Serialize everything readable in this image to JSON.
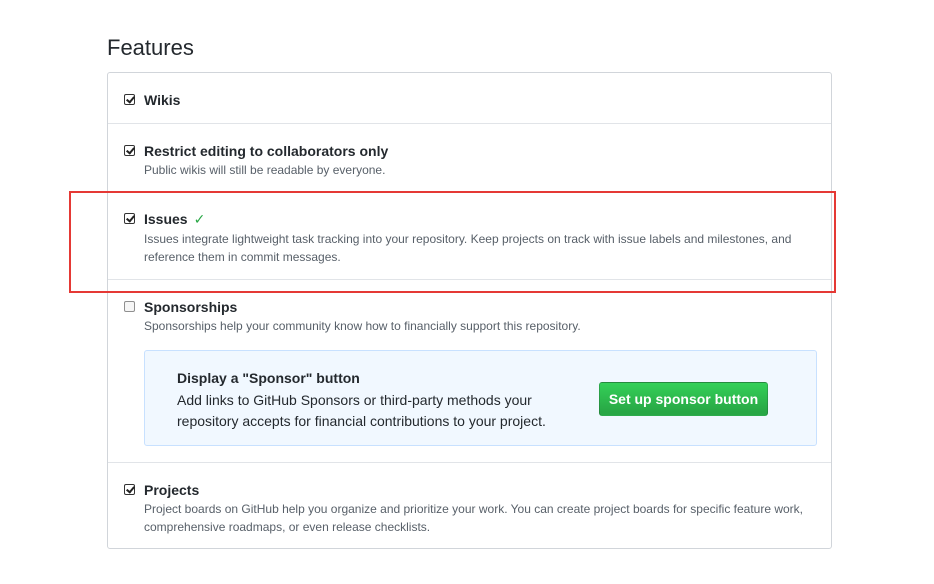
{
  "section_title": "Features",
  "features": {
    "wikis": {
      "label": "Wikis",
      "checked": true
    },
    "restrict_editing": {
      "label": "Restrict editing to collaborators only",
      "note": "Public wikis will still be readable by everyone.",
      "checked": true
    },
    "issues": {
      "label": "Issues",
      "note": "Issues integrate lightweight task tracking into your repository. Keep projects on track with issue labels and milestones, and reference them in commit messages.",
      "checked": true,
      "status_icon": "check-icon"
    },
    "sponsorships": {
      "label": "Sponsorships",
      "note": "Sponsorships help your community know how to financially support this repository.",
      "checked": false,
      "callout": {
        "title": "Display a \"Sponsor\" button",
        "description": "Add links to GitHub Sponsors or third-party methods your repository accepts for financial contributions to your project.",
        "button_label": "Set up sponsor button"
      }
    },
    "projects": {
      "label": "Projects",
      "note": "Project boards on GitHub help you organize and prioritize your work. You can create project boards for specific feature work, comprehensive roadmaps, or even release checklists.",
      "checked": true
    }
  },
  "colors": {
    "highlight_border": "#e53935",
    "success_green": "#28a745",
    "callout_bg": "#f1f8ff"
  }
}
